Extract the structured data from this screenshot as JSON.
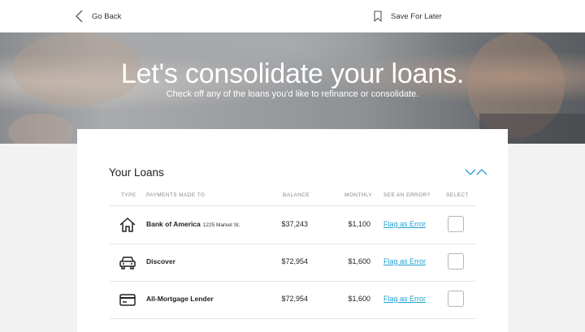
{
  "topbar": {
    "back_label": "Go Back",
    "save_label": "Save For Later"
  },
  "hero": {
    "title": "Let's consolidate your loans.",
    "subtitle": "Check off any of the loans you'd like to refinance or consolidate."
  },
  "loans": {
    "title": "Your Loans",
    "columns": [
      "TYPE",
      "PAYMENTS MADE TO",
      "BALANCE",
      "MONTHLY",
      "SEE AN ERROR?",
      "SELECT"
    ],
    "rows": [
      {
        "icon": "house-icon",
        "name": "Bank of America",
        "address": "1225 Market St.",
        "balance": "$37,243",
        "monthly": "$1,100",
        "flag": "Flag as Error",
        "selected": false
      },
      {
        "icon": "car-icon",
        "name": "Discover",
        "address": "",
        "balance": "$72,954",
        "monthly": "$1,600",
        "flag": "Flag as Error",
        "selected": false
      },
      {
        "icon": "credit-card-icon",
        "name": "All-Mortgage Lender",
        "address": "",
        "balance": "$72,954",
        "monthly": "$1,600",
        "flag": "Flag as Error",
        "selected": false
      }
    ]
  },
  "colors": {
    "accent": "#1f9fd0",
    "text": "#222222",
    "page_bg": "#f2f2f2"
  }
}
